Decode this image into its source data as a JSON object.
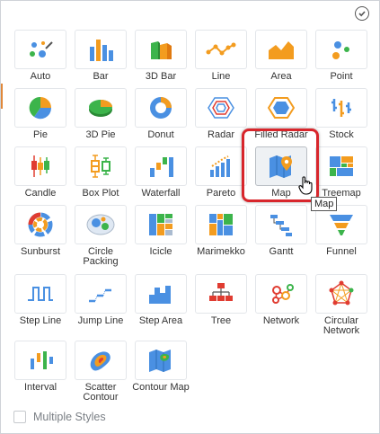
{
  "chart_types": [
    {
      "label": "Auto",
      "icon": "auto-icon"
    },
    {
      "label": "Bar",
      "icon": "bar-chart-icon"
    },
    {
      "label": "3D Bar",
      "icon": "3d-bar-chart-icon"
    },
    {
      "label": "Line",
      "icon": "line-chart-icon"
    },
    {
      "label": "Area",
      "icon": "area-chart-icon"
    },
    {
      "label": "Point",
      "icon": "point-chart-icon"
    },
    {
      "label": "Pie",
      "icon": "pie-chart-icon"
    },
    {
      "label": "3D Pie",
      "icon": "3d-pie-chart-icon"
    },
    {
      "label": "Donut",
      "icon": "donut-chart-icon"
    },
    {
      "label": "Radar",
      "icon": "radar-chart-icon"
    },
    {
      "label": "Filled Radar",
      "icon": "filled-radar-chart-icon"
    },
    {
      "label": "Stock",
      "icon": "stock-chart-icon"
    },
    {
      "label": "Candle",
      "icon": "candle-chart-icon"
    },
    {
      "label": "Box Plot",
      "icon": "box-plot-icon"
    },
    {
      "label": "Waterfall",
      "icon": "waterfall-chart-icon"
    },
    {
      "label": "Pareto",
      "icon": "pareto-chart-icon"
    },
    {
      "label": "Map",
      "icon": "map-icon"
    },
    {
      "label": "Treemap",
      "icon": "treemap-icon"
    },
    {
      "label": "Sunburst",
      "icon": "sunburst-icon"
    },
    {
      "label": "Circle Packing",
      "icon": "circle-packing-icon"
    },
    {
      "label": "Icicle",
      "icon": "icicle-icon"
    },
    {
      "label": "Marimekko",
      "icon": "marimekko-icon"
    },
    {
      "label": "Gantt",
      "icon": "gantt-icon"
    },
    {
      "label": "Funnel",
      "icon": "funnel-icon"
    },
    {
      "label": "Step Line",
      "icon": "step-line-icon"
    },
    {
      "label": "Jump Line",
      "icon": "jump-line-icon"
    },
    {
      "label": "Step Area",
      "icon": "step-area-icon"
    },
    {
      "label": "Tree",
      "icon": "tree-icon"
    },
    {
      "label": "Network",
      "icon": "network-icon"
    },
    {
      "label": "Circular Network",
      "icon": "circular-network-icon"
    },
    {
      "label": "Interval",
      "icon": "interval-chart-icon"
    },
    {
      "label": "Scatter Contour",
      "icon": "scatter-contour-icon"
    },
    {
      "label": "Contour Map",
      "icon": "contour-map-icon"
    }
  ],
  "selected": "Map",
  "tooltip": "Map",
  "multiple_styles_label": "Multiple Styles",
  "multiple_styles_checked": false,
  "colors": {
    "blue": "#4a90e2",
    "orange": "#f39c1f",
    "green": "#3cb44b",
    "red": "#e03c31",
    "highlight": "#d8262c"
  }
}
